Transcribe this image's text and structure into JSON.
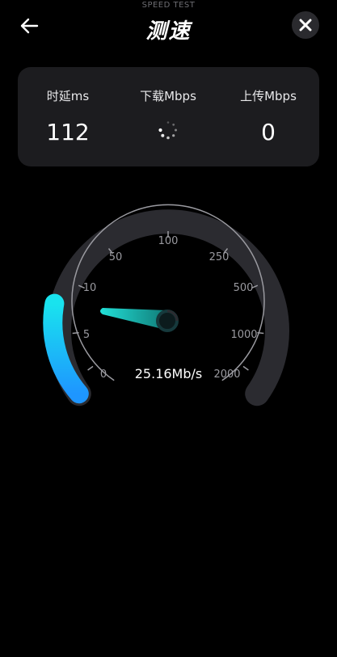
{
  "header": {
    "caption": "SPEED TEST",
    "title": "测速",
    "back_icon": "arrow-left-icon",
    "close_icon": "close-icon"
  },
  "stats": {
    "latency": {
      "label": "时延ms",
      "value": "112"
    },
    "download": {
      "label": "下载Mbps",
      "value": "",
      "state_icon": "loading-spinner-icon"
    },
    "upload": {
      "label": "上传Mbps",
      "value": "0"
    }
  },
  "gauge": {
    "speed_text": "25.16Mb/s",
    "current_speed": 25.16,
    "scale_labels": [
      "0",
      "5",
      "10",
      "50",
      "100",
      "250",
      "500",
      "1000",
      "2000"
    ],
    "colors": {
      "track": "#2b2b30",
      "progress_start": "#1e96ff",
      "progress_end": "#19e3ee",
      "needle": "#22e0d8",
      "tick": "#9a9aa0"
    }
  }
}
